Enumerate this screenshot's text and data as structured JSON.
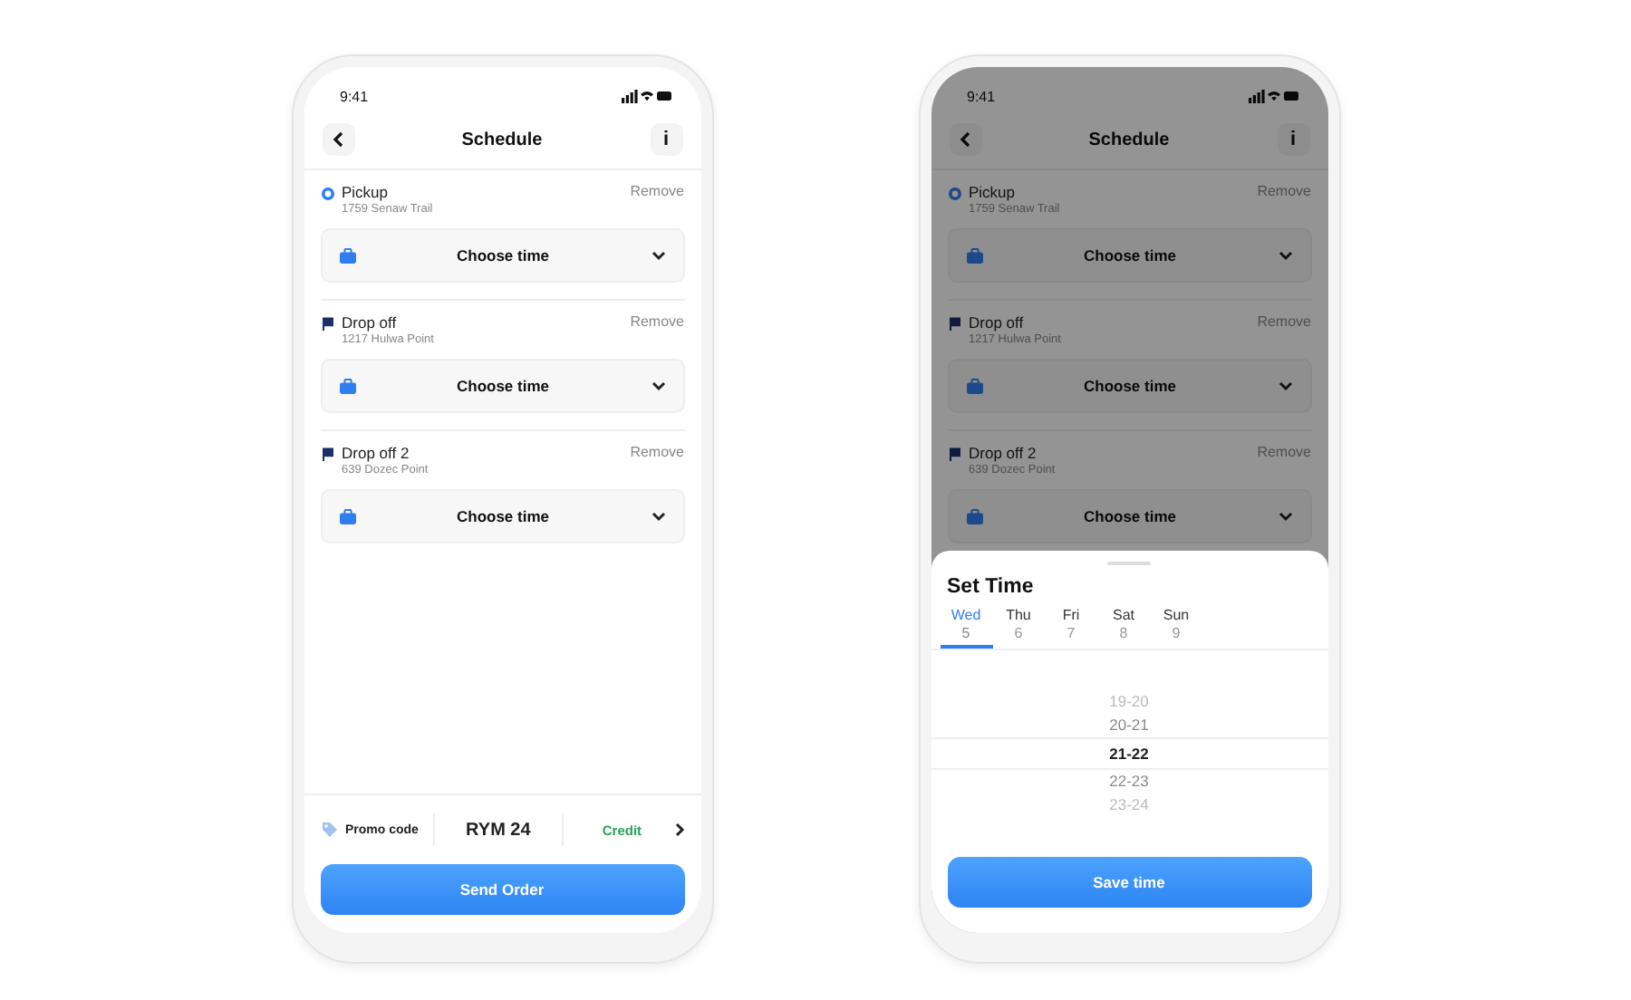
{
  "phones": [
    {
      "status_time": "9:41",
      "title": "Schedule",
      "info": "i",
      "stops": [
        {
          "kind": "pickup",
          "label": "Pickup",
          "address": "1759 Senaw Trail",
          "remove": "Remove",
          "time": "Choose time"
        },
        {
          "kind": "dropoff",
          "label": "Drop off",
          "address": "1217 Hulwa Point",
          "remove": "Remove",
          "time": "Choose time"
        },
        {
          "kind": "dropoff",
          "label": "Drop off 2",
          "address": "639 Dozec Point",
          "remove": "Remove",
          "time": "Choose time"
        }
      ],
      "footer": {
        "promo_label": "Promo code",
        "promo_code": "RYM 24",
        "credit": "Credit",
        "button": "Send Order"
      }
    },
    {
      "status_time": "9:41",
      "title": "Schedule",
      "info": "i",
      "stops": [
        {
          "kind": "pickup",
          "label": "Pickup",
          "address": "1759 Senaw Trail",
          "remove": "Remove",
          "time": "Choose time"
        },
        {
          "kind": "dropoff",
          "label": "Drop off",
          "address": "1217 Hulwa Point",
          "remove": "Remove",
          "time": "Choose time"
        },
        {
          "kind": "dropoff",
          "label": "Drop off 2",
          "address": "639 Dozec Point",
          "remove": "Remove",
          "time": "Choose time"
        }
      ],
      "sheet": {
        "title": "Set Time",
        "days": [
          {
            "name": "Wed",
            "date": "5",
            "selected": true
          },
          {
            "name": "Thu",
            "date": "6",
            "selected": false
          },
          {
            "name": "Fri",
            "date": "7",
            "selected": false
          },
          {
            "name": "Sat",
            "date": "8",
            "selected": false
          },
          {
            "name": "Sun",
            "date": "9",
            "selected": false
          }
        ],
        "times": [
          {
            "label": "19-20",
            "selected": false
          },
          {
            "label": "20-21",
            "selected": false
          },
          {
            "label": "21-22",
            "selected": true
          },
          {
            "label": "22-23",
            "selected": false
          },
          {
            "label": "23-24",
            "selected": false
          }
        ],
        "button": "Save time"
      }
    }
  ]
}
